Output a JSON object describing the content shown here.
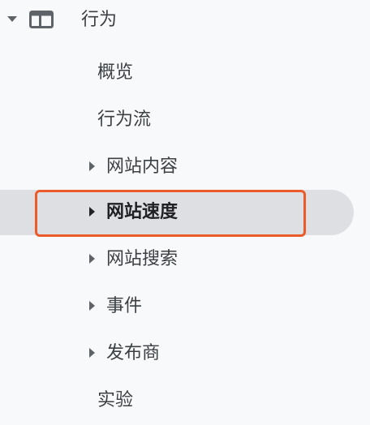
{
  "section": {
    "label": "行为",
    "icon": "panel-layout-icon",
    "expanded": true
  },
  "items": [
    {
      "label": "概览",
      "has_submenu": false
    },
    {
      "label": "行为流",
      "has_submenu": false
    },
    {
      "label": "网站内容",
      "has_submenu": true
    },
    {
      "label": "网站速度",
      "has_submenu": true,
      "selected": true
    },
    {
      "label": "网站搜索",
      "has_submenu": true
    },
    {
      "label": "事件",
      "has_submenu": true
    },
    {
      "label": "发布商",
      "has_submenu": true
    },
    {
      "label": "实验",
      "has_submenu": false
    }
  ],
  "colors": {
    "background": "#f8f9fa",
    "selected_background": "#dedfe3",
    "highlight_border": "#ea5a2b",
    "text": "#3c4043"
  }
}
